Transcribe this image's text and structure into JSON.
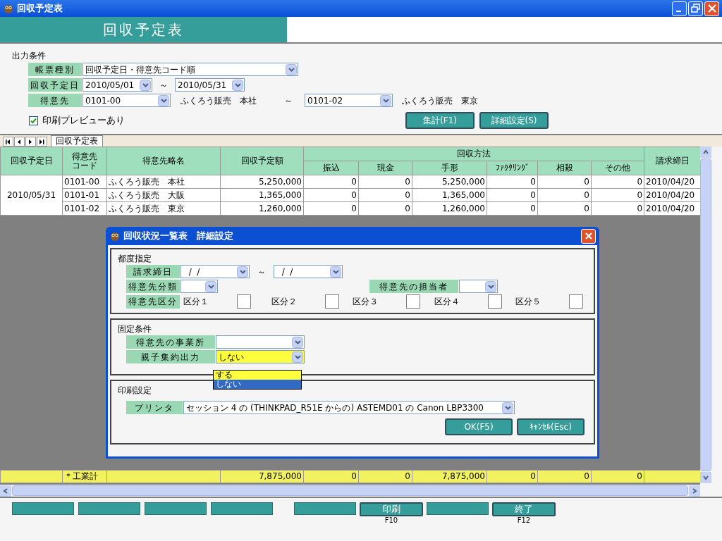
{
  "window": {
    "title": "回収予定表"
  },
  "header_title": "回収予定表",
  "conditions": {
    "section_label": "出力条件",
    "report_type": {
      "label": "帳票種別",
      "value": "回収予定日・得意先コード順"
    },
    "date": {
      "label": "回収予定日",
      "from": "2010/05/01",
      "separator": "～",
      "to": "2010/05/31"
    },
    "customer": {
      "label": "得意先",
      "from": "0101-00",
      "from_name": "ふくろう販売　本社",
      "separator": "～",
      "to": "0101-02",
      "to_name": "ふくろう販売　東京"
    },
    "preview": {
      "label": "印刷プレビューあり",
      "checked": true
    },
    "buttons": [
      "集計(F1)",
      "詳細設定(S)"
    ]
  },
  "tabs": [
    {
      "label": "回収予定表",
      "selected": true
    }
  ],
  "table": {
    "columns": [
      "回収予定日",
      "得意先コード",
      "得意先略名",
      "回収予定額",
      "請求締日"
    ],
    "group_header": "回収方法",
    "sub_columns": [
      "振込",
      "現金",
      "手形",
      "ﾌｧｸﾀﾘﾝｸﾞ",
      "相殺",
      "その他"
    ],
    "group_date": "2010/05/31",
    "rows": [
      {
        "code": "0101-00",
        "name": "ふくろう販売　本社",
        "amount": "5,250,000",
        "methods": [
          "0",
          "0",
          "5,250,000",
          "0",
          "0",
          "0"
        ],
        "closing": "2010/04/20"
      },
      {
        "code": "0101-01",
        "name": "ふくろう販売　大阪",
        "amount": "1,365,000",
        "methods": [
          "0",
          "0",
          "1,365,000",
          "0",
          "0",
          "0"
        ],
        "closing": "2010/04/20"
      },
      {
        "code": "0101-02",
        "name": "ふくろう販売　東京",
        "amount": "1,260,000",
        "methods": [
          "0",
          "0",
          "1,260,000",
          "0",
          "0",
          "0"
        ],
        "closing": "2010/04/20"
      }
    ],
    "total": {
      "label": "＊工業計",
      "amount": "7,875,000",
      "methods": [
        "0",
        "0",
        "7,875,000",
        "0",
        "0",
        "0"
      ]
    }
  },
  "function_keys": [
    {
      "kind": "blank"
    },
    {
      "kind": "blank"
    },
    {
      "kind": "blank"
    },
    {
      "kind": "blank"
    },
    {
      "kind": "gap"
    },
    {
      "kind": "blank"
    },
    {
      "kind": "key",
      "label": "印刷",
      "key": "F10"
    },
    {
      "kind": "blank"
    },
    {
      "kind": "key",
      "label": "終了",
      "key": "F12"
    }
  ],
  "dialog": {
    "title": "回収状況一覧表　詳細設定",
    "per_time": {
      "label": "都度指定",
      "closing_label": "請求締日",
      "closing_from": "  /  /",
      "separator": "～",
      "closing_to": "  /  /",
      "class_label": "得意先分類",
      "rep_label": "得意先の担当者",
      "category_label": "得意先区分",
      "categories": [
        {
          "label": "区分１",
          "checked": false
        },
        {
          "label": "区分２",
          "checked": false
        },
        {
          "label": "区分３",
          "checked": false
        },
        {
          "label": "区分４",
          "checked": false
        },
        {
          "label": "区分５",
          "checked": false
        }
      ]
    },
    "fixed": {
      "label": "固定条件",
      "office_label": "得意先の事業所",
      "consolidate_label": "親子集約出力",
      "consolidate_value": "しない",
      "options": [
        {
          "label": "する",
          "selected": false
        },
        {
          "label": "しない",
          "selected": true
        }
      ]
    },
    "print": {
      "label": "印刷設定",
      "printer_label": "プリンタ",
      "printer_value": "セッション 4 の (THINKPAD_R51E からの) ASTEMD01 の Canon LBP3300"
    },
    "buttons": [
      "OK(F5)",
      "ｷｬﾝｾﾙ(Esc)"
    ]
  }
}
